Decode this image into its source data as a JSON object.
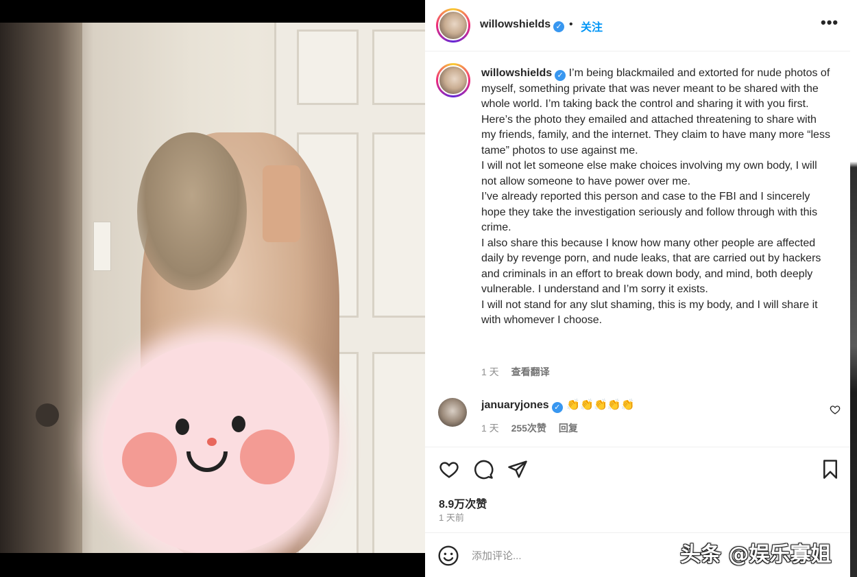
{
  "post": {
    "author": "willowshields",
    "follow_label": "关注",
    "dot": "•",
    "more": "•••"
  },
  "caption": {
    "author": "willowshields",
    "paragraphs": [
      "I’m being blackmailed and extorted for nude photos of myself, something private that was never meant to be shared with the whole world. I’m taking back the control and sharing it with you first. Here’s the photo they emailed and attached threatening to share with my friends, family, and the internet. They claim to have many more “less tame” photos to use against me.",
      "I will not let someone else make choices involving my own body, I will not allow someone to have power over me.",
      "I’ve already reported this person and case to the FBI and I sincerely hope they take the investigation seriously and follow through with this crime.",
      "I also share this because I know how many other people are affected daily by revenge porn, and nude leaks, that are carried out by hackers and criminals in an effort to break down body, and mind, both deeply vulnerable. I understand and I’m sorry it exists.",
      "I will not stand for any slut shaming, this is my body, and I will share it with whomever I choose."
    ],
    "time": "1 天",
    "translate": "查看翻译"
  },
  "comment": {
    "author": "januaryjones",
    "text": "👏👏👏👏👏",
    "time": "1 天",
    "likes": "255次赞",
    "reply": "回复"
  },
  "actions": {
    "likes": "8.9万次赞",
    "time_ago": "1 天前"
  },
  "comment_box": {
    "placeholder": "添加评论...",
    "watermark": "头条 @娱乐寡姐"
  },
  "icons": {
    "verified": "verified-badge-icon",
    "like": "heart-icon",
    "comment": "comment-bubble-icon",
    "share": "paper-plane-icon",
    "save": "bookmark-icon",
    "emoji": "emoji-smile-icon",
    "more": "more-options-icon"
  },
  "colors": {
    "accent_blue": "#0095f6",
    "verified_blue": "#3897f0",
    "text_primary": "#262626",
    "text_secondary": "#8e8e8e"
  }
}
